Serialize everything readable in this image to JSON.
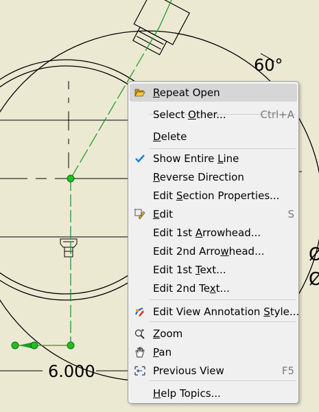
{
  "drawing": {
    "angle_label": "60°",
    "distance_label": "6.000",
    "edge_glyph_1": "Ø",
    "edge_glyph_2": "Ø"
  },
  "context_menu": {
    "items": [
      {
        "id": "repeat-open",
        "pre": "",
        "acc": "R",
        "post": "epeat Open",
        "shortcut": "",
        "icon": "folder-open-icon",
        "highlighted": true
      },
      {
        "id": "select-other",
        "pre": "Select ",
        "acc": "O",
        "post": "ther...",
        "shortcut": "Ctrl+A",
        "icon": ""
      },
      {
        "id": "delete",
        "pre": "",
        "acc": "D",
        "post": "elete",
        "shortcut": "",
        "icon": ""
      },
      {
        "id": "show-entire-line",
        "pre": "Show Entire ",
        "acc": "L",
        "post": "ine",
        "shortcut": "",
        "icon": "checkmark-icon",
        "checked": true
      },
      {
        "id": "reverse-direction",
        "pre": "",
        "acc": "R",
        "post": "everse Direction",
        "shortcut": "",
        "icon": ""
      },
      {
        "id": "edit-section-properties",
        "pre": "Edit ",
        "acc": "S",
        "post": "ection Properties...",
        "shortcut": "",
        "icon": ""
      },
      {
        "id": "edit",
        "pre": "",
        "acc": "E",
        "post": "dit",
        "shortcut": "S",
        "icon": "edit-sketch-icon"
      },
      {
        "id": "edit-1st-arrowhead",
        "pre": "Edit 1st ",
        "acc": "A",
        "post": "rrowhead...",
        "shortcut": "",
        "icon": ""
      },
      {
        "id": "edit-2nd-arrowhead",
        "pre": "Edit 2nd Arro",
        "acc": "w",
        "post": "head...",
        "shortcut": "",
        "icon": ""
      },
      {
        "id": "edit-1st-text",
        "pre": "Edit 1st ",
        "acc": "T",
        "post": "ext...",
        "shortcut": "",
        "icon": ""
      },
      {
        "id": "edit-2nd-text",
        "pre": "Edit 2nd Te",
        "acc": "x",
        "post": "t...",
        "shortcut": "",
        "icon": ""
      },
      {
        "id": "edit-view-annotation-style",
        "pre": "Edit View Annotation ",
        "acc": "S",
        "post": "tyle...",
        "shortcut": "",
        "icon": "annotation-style-icon"
      },
      {
        "id": "zoom",
        "pre": "",
        "acc": "Z",
        "post": "oom",
        "shortcut": "",
        "icon": "zoom-icon"
      },
      {
        "id": "pan",
        "pre": "",
        "acc": "P",
        "post": "an",
        "shortcut": "",
        "icon": "pan-hand-icon"
      },
      {
        "id": "previous-view",
        "pre": "Previous View",
        "acc": "",
        "post": "",
        "shortcut": "F5",
        "icon": "previous-view-icon"
      },
      {
        "id": "help-topics",
        "pre": "",
        "acc": "H",
        "post": "elp Topics...",
        "shortcut": "",
        "icon": ""
      }
    ]
  }
}
